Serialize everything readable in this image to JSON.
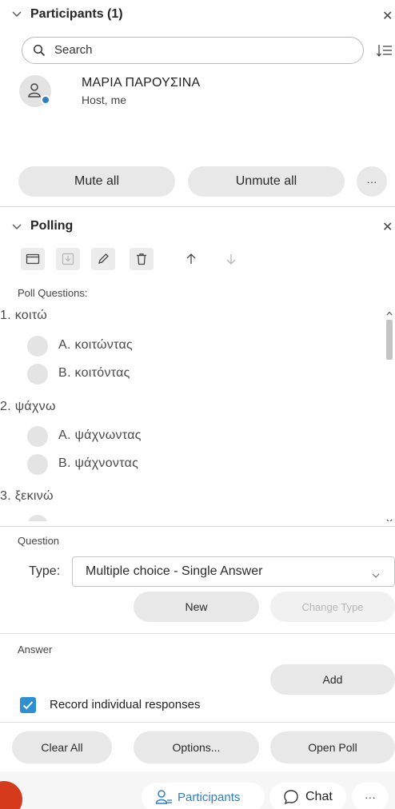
{
  "participants": {
    "title": "Participants (1)",
    "search_placeholder": "Search",
    "user": {
      "name": "ΜΑΡΙΑ ΠΑΡΟΥΣΙΝΑ",
      "role": "Host, me"
    },
    "mute_all": "Mute all",
    "unmute_all": "Unmute all",
    "more": "···"
  },
  "polling": {
    "title": "Polling",
    "poll_questions_label": "Poll Questions:",
    "questions": [
      {
        "label": "1. κοιτώ",
        "options": [
          "A. κοιτώντας",
          "B. κοιτόντας"
        ]
      },
      {
        "label": "2. ψάχνω",
        "options": [
          "A. ψάχνωντας",
          "B. ψάχνοντας"
        ]
      },
      {
        "label": "3. ξεκινώ",
        "options": []
      }
    ],
    "question_section": "Question",
    "type_label": "Type:",
    "type_value": "Multiple choice - Single Answer",
    "new_button": "New",
    "change_type_button": "Change Type",
    "answer_section": "Answer",
    "add_button": "Add",
    "record_responses": "Record individual responses",
    "record_checked": true,
    "clear_all": "Clear All",
    "options": "Options...",
    "open_poll": "Open Poll"
  },
  "bottom_bar": {
    "participants": "Participants",
    "chat": "Chat",
    "more": "···"
  },
  "colors": {
    "accent": "#2f7fc1",
    "checkbox": "#2e8fd1",
    "red": "#d63a1c"
  }
}
